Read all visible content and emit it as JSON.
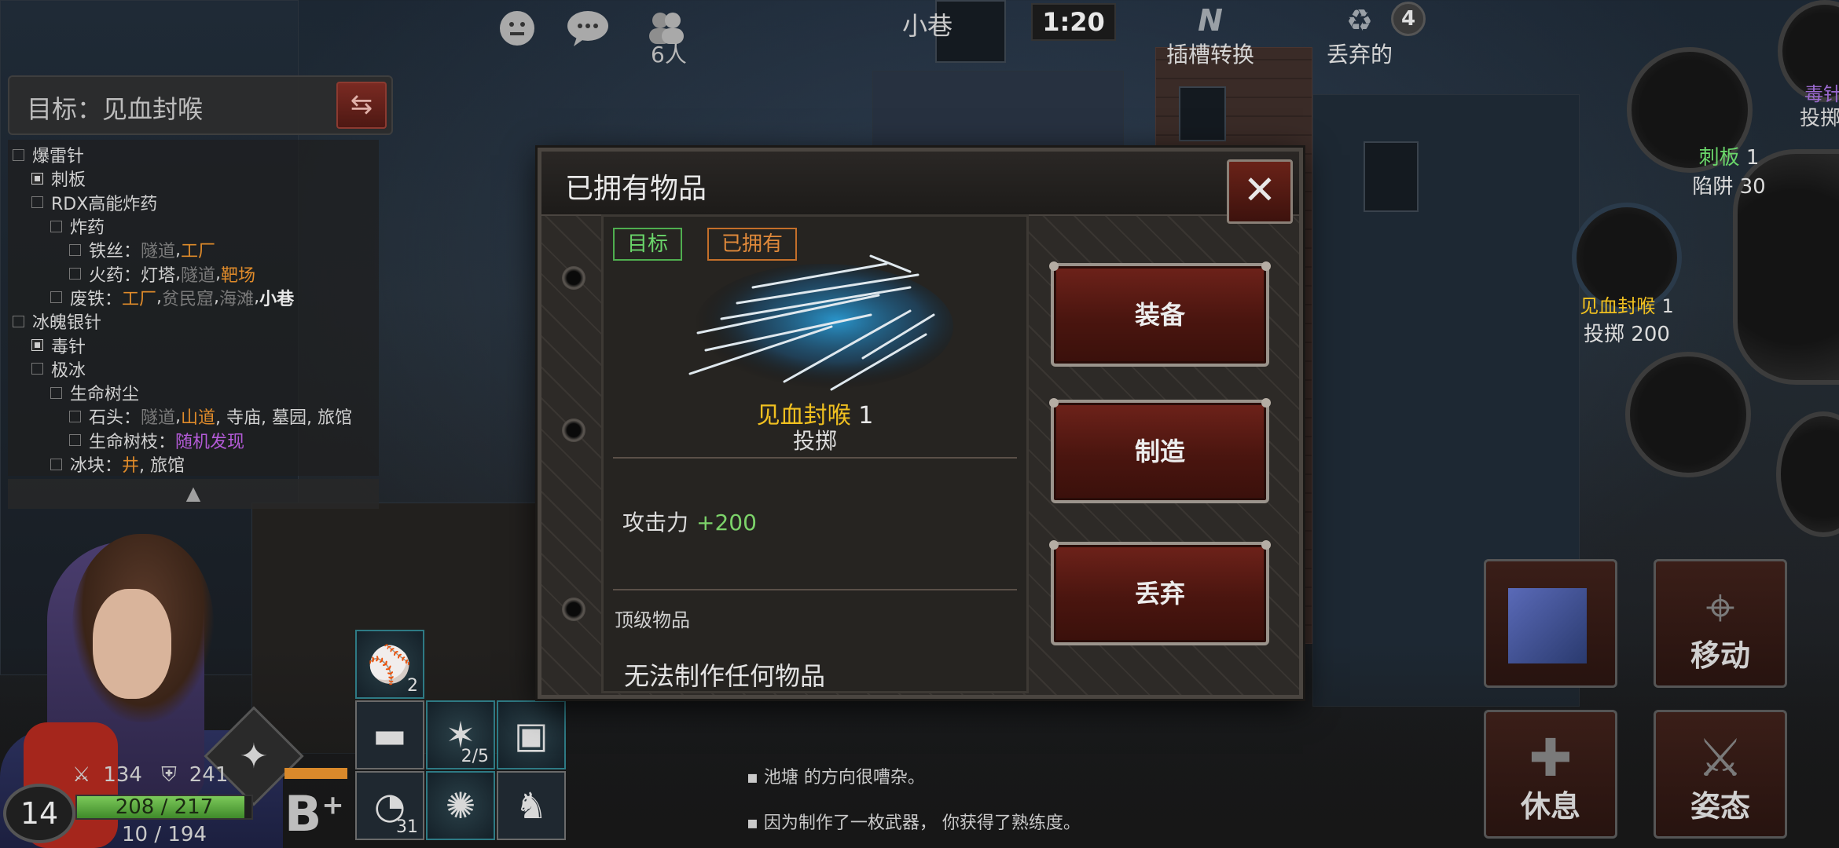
{
  "topbar": {
    "emote_icon": "smile-icon",
    "chat_icon": "chat-bubble-icon",
    "players_icon": "people-icon",
    "player_count": "6人",
    "location": "小巷",
    "timer": "1:20",
    "slot_switch_label": "插槽转换",
    "slot_switch_icon": "N",
    "discard_label": "丢弃的",
    "discard_icon": "recycle-icon",
    "discard_count": "4"
  },
  "target": {
    "title": "目标：见血封喉",
    "swap_icon": "swap-arrows-icon"
  },
  "tree": [
    {
      "indent": 0,
      "check": false,
      "name": "爆雷针",
      "locs": []
    },
    {
      "indent": 1,
      "check": true,
      "name": "刺板",
      "locs": []
    },
    {
      "indent": 1,
      "check": false,
      "name": "RDX高能炸药",
      "locs": []
    },
    {
      "indent": 2,
      "check": false,
      "name": "炸药",
      "locs": []
    },
    {
      "indent": 3,
      "check": false,
      "name": "铁丝：",
      "locs": [
        {
          "t": "隧道",
          "c": "gray"
        },
        {
          "t": ", ",
          "c": "light"
        },
        {
          "t": "工厂",
          "c": "orange"
        }
      ]
    },
    {
      "indent": 3,
      "check": false,
      "name": "火药：",
      "locs": [
        {
          "t": "灯塔",
          "c": "light"
        },
        {
          "t": ", ",
          "c": "light"
        },
        {
          "t": "隧道",
          "c": "gray"
        },
        {
          "t": ", ",
          "c": "light"
        },
        {
          "t": "靶场",
          "c": "orange"
        }
      ]
    },
    {
      "indent": 2,
      "check": false,
      "name": "废铁：",
      "locs": [
        {
          "t": "工厂",
          "c": "orange"
        },
        {
          "t": ", ",
          "c": "light"
        },
        {
          "t": "贫民窟",
          "c": "gray"
        },
        {
          "t": ", ",
          "c": "light"
        },
        {
          "t": "海滩",
          "c": "gray"
        },
        {
          "t": ", ",
          "c": "light"
        },
        {
          "t": "小巷",
          "c": "white"
        }
      ]
    },
    {
      "indent": 0,
      "check": false,
      "name": "冰魄银针",
      "locs": []
    },
    {
      "indent": 1,
      "check": true,
      "name": "毒针",
      "locs": []
    },
    {
      "indent": 1,
      "check": false,
      "name": "极冰",
      "locs": []
    },
    {
      "indent": 2,
      "check": false,
      "name": "生命树尘",
      "locs": []
    },
    {
      "indent": 3,
      "check": false,
      "name": "石头：",
      "locs": [
        {
          "t": "隧道",
          "c": "gray"
        },
        {
          "t": ", ",
          "c": "light"
        },
        {
          "t": "山道",
          "c": "orange"
        },
        {
          "t": ", 寺庙, 墓园, 旅馆",
          "c": "light"
        }
      ]
    },
    {
      "indent": 3,
      "check": false,
      "name": "生命树枝：",
      "locs": [
        {
          "t": "随机发现",
          "c": "purple"
        }
      ]
    },
    {
      "indent": 2,
      "check": false,
      "name": "冰块：",
      "locs": [
        {
          "t": "井",
          "c": "orange"
        },
        {
          "t": ", 旅馆",
          "c": "light"
        }
      ]
    }
  ],
  "tree_collapse": "▲",
  "character": {
    "level": "14",
    "attack": "134",
    "defense": "241",
    "hp_text": "208 / 217",
    "hp_ratio": 0.958,
    "xp_text": "10 / 194",
    "grade": "B",
    "grade_plus": "+",
    "special_icon": "shuriken-icon"
  },
  "inventory": [
    {
      "icon": "baseball-icon",
      "glyph": "⚾",
      "count": "2"
    },
    {
      "icon": "gold-bar-icon",
      "glyph": "▬",
      "count": ""
    },
    {
      "icon": "crystal-shards-icon",
      "glyph": "✶",
      "count": "2/5"
    },
    {
      "icon": "cat-box-icon",
      "glyph": "▣",
      "count": ""
    },
    {
      "icon": "meat-icon",
      "glyph": "◔",
      "count": "31"
    },
    {
      "icon": "dark-splash-icon",
      "glyph": "✺",
      "count": ""
    },
    {
      "icon": "purple-figure-icon",
      "glyph": "♞",
      "count": ""
    }
  ],
  "log": [
    "池塘 的方向很嘈杂。",
    "因为制作了一枚武器， 你获得了熟练度。"
  ],
  "right": {
    "poison_label": "毒针",
    "throw_label": "投掷",
    "trap_name": "刺板",
    "trap_count": "1",
    "trap_stat": "陷阱 30",
    "needle_name": "见血封喉",
    "needle_count": "1",
    "needle_stat": "投掷 200"
  },
  "actions": {
    "move": "移动",
    "rest": "休息",
    "stance": "姿态"
  },
  "dialog": {
    "title": "已拥有物品",
    "close_icon": "close-x-icon",
    "tag_target": "目标",
    "tag_owned": "已拥有",
    "item_name": "见血封喉",
    "item_count": "1",
    "item_type": "投掷",
    "attack_label": "攻击力",
    "attack_value": "+200",
    "top_grade_label": "顶级物品",
    "cannot_craft": "无法制作任何物品",
    "btn_equip": "装备",
    "btn_craft": "制造",
    "btn_discard": "丢弃"
  }
}
